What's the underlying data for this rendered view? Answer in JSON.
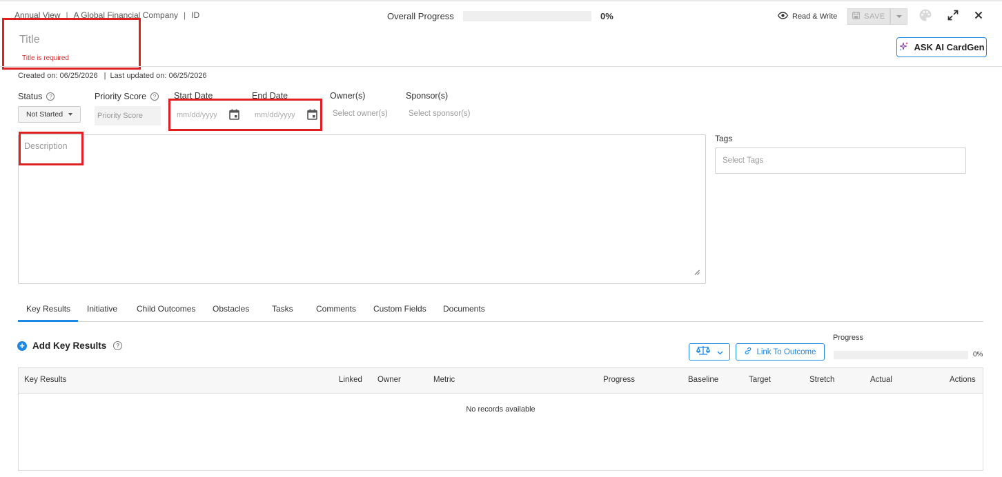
{
  "header": {
    "breadcrumb": [
      "Annual View",
      "A Global Financial Company",
      "ID"
    ],
    "overall_progress_label": "Overall Progress",
    "overall_progress_value": 0,
    "overall_progress_text": "0%",
    "mode_label": "Read & Write",
    "save_label": "SAVE",
    "icons": [
      "eye-icon",
      "save-disk-icon",
      "palette-icon",
      "expand-icon",
      "close-icon"
    ]
  },
  "title": {
    "placeholder": "Title",
    "error": "Title is required"
  },
  "ask_ai": {
    "label": "ASK AI CardGen"
  },
  "meta": {
    "created_label": "Created on:",
    "created_value": "06/25/2026",
    "updated_label": "Last updated on:",
    "updated_value": "06/25/2026"
  },
  "fields": {
    "status_label": "Status",
    "status_value": "Not Started",
    "priority_label": "Priority Score",
    "priority_placeholder": "Priority Score",
    "start_label": "Start Date",
    "start_placeholder": "mm/dd/yyyy",
    "end_label": "End Date",
    "end_placeholder": "mm/dd/yyyy",
    "owner_label": "Owner(s)",
    "owner_placeholder": "Select owner(s)",
    "sponsor_label": "Sponsor(s)",
    "sponsor_placeholder": "Select sponsor(s)"
  },
  "description": {
    "placeholder": "Description"
  },
  "tags": {
    "label": "Tags",
    "placeholder": "Select Tags"
  },
  "tabs": [
    "Key Results",
    "Initiative",
    "Child Outcomes",
    "Obstacles",
    "Tasks",
    "Comments",
    "Custom Fields",
    "Documents"
  ],
  "active_tab": "Key Results",
  "key_results": {
    "add_label": "Add Key Results",
    "link_label": "Link To Outcome",
    "progress_label": "Progress",
    "progress_value": 0,
    "progress_text": "0%",
    "columns": [
      "Key Results",
      "Linked",
      "Owner",
      "Metric",
      "Progress",
      "Baseline",
      "Target",
      "Stretch",
      "Actual",
      "Actions"
    ],
    "empty_text": "No records available"
  },
  "colors": {
    "accent": "#1e88e5",
    "error": "#d32f2f",
    "highlight_box": "#e02020"
  }
}
